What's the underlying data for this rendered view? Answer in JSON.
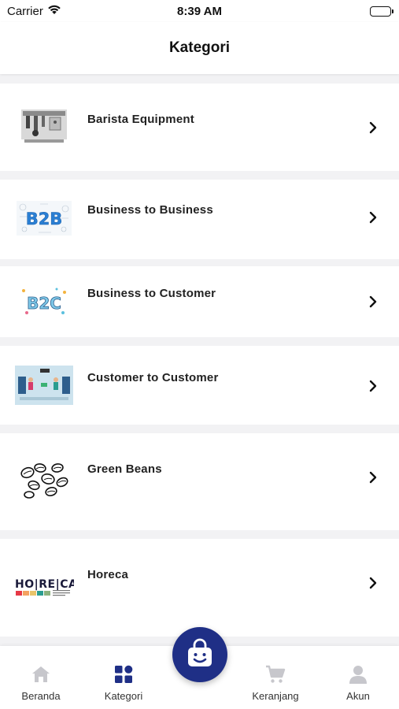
{
  "status_bar": {
    "carrier": "Carrier",
    "time": "8:39 AM"
  },
  "header": {
    "title": "Kategori"
  },
  "categories": [
    {
      "label": "Barista Equipment",
      "thumb": "barista-equipment-image"
    },
    {
      "label": "Business to Business",
      "thumb": "b2b-image",
      "thumb_text": "B2B"
    },
    {
      "label": "Business to Customer",
      "thumb": "b2c-image",
      "thumb_text": "B2C"
    },
    {
      "label": "Customer to Customer",
      "thumb": "c2c-image"
    },
    {
      "label": "Green Beans",
      "thumb": "green-beans-image"
    },
    {
      "label": "Horeca",
      "thumb": "horeca-image",
      "thumb_text": "HO|RE|CA"
    }
  ],
  "tabbar": {
    "items": [
      {
        "label": "Beranda",
        "icon": "home-icon"
      },
      {
        "label": "Kategori",
        "icon": "grid-icon"
      },
      {
        "label": "Keranjang",
        "icon": "cart-icon"
      },
      {
        "label": "Akun",
        "icon": "person-icon"
      }
    ],
    "center_button_icon": "shopping-bag-icon"
  },
  "colors": {
    "accent": "#1f2f86",
    "inactive": "#c7c7cc",
    "background": "#f2f2f4"
  }
}
